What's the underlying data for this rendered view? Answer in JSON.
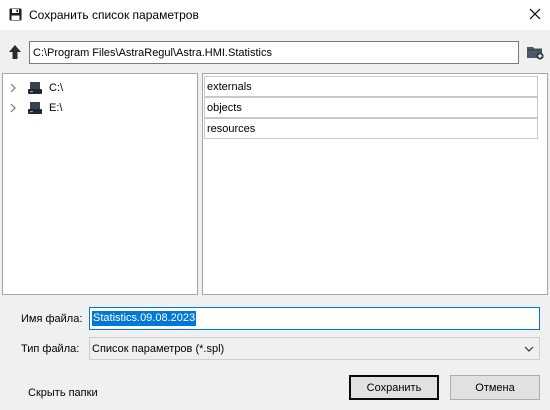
{
  "window": {
    "title": "Сохранить список параметров",
    "icon": "floppy-disk-icon"
  },
  "path_bar": {
    "path": "C:\\Program Files\\AstraRegul\\Astra.HMI.Statistics",
    "up_icon": "arrow-up-icon",
    "new_folder_icon": "new-folder-icon"
  },
  "tree": {
    "items": [
      {
        "label": "C:\\",
        "icon": "drive-icon",
        "expanded": false
      },
      {
        "label": "E:\\",
        "icon": "drive-icon",
        "expanded": false
      }
    ]
  },
  "list": {
    "items": [
      {
        "label": "externals"
      },
      {
        "label": "objects"
      },
      {
        "label": "resources"
      }
    ]
  },
  "form": {
    "filename_label": "Имя файла:",
    "filename_value": "Statistics.09.08.2023",
    "filetype_label": "Тип файла:",
    "filetype_value": "Список параметров (*.spl)"
  },
  "footer": {
    "hide_folders": "Скрыть папки",
    "save": "Сохранить",
    "cancel": "Отмена"
  },
  "colors": {
    "accent": "#0078d7",
    "window_bg": "#f0f0f0",
    "panel_bg": "#ffffff"
  }
}
